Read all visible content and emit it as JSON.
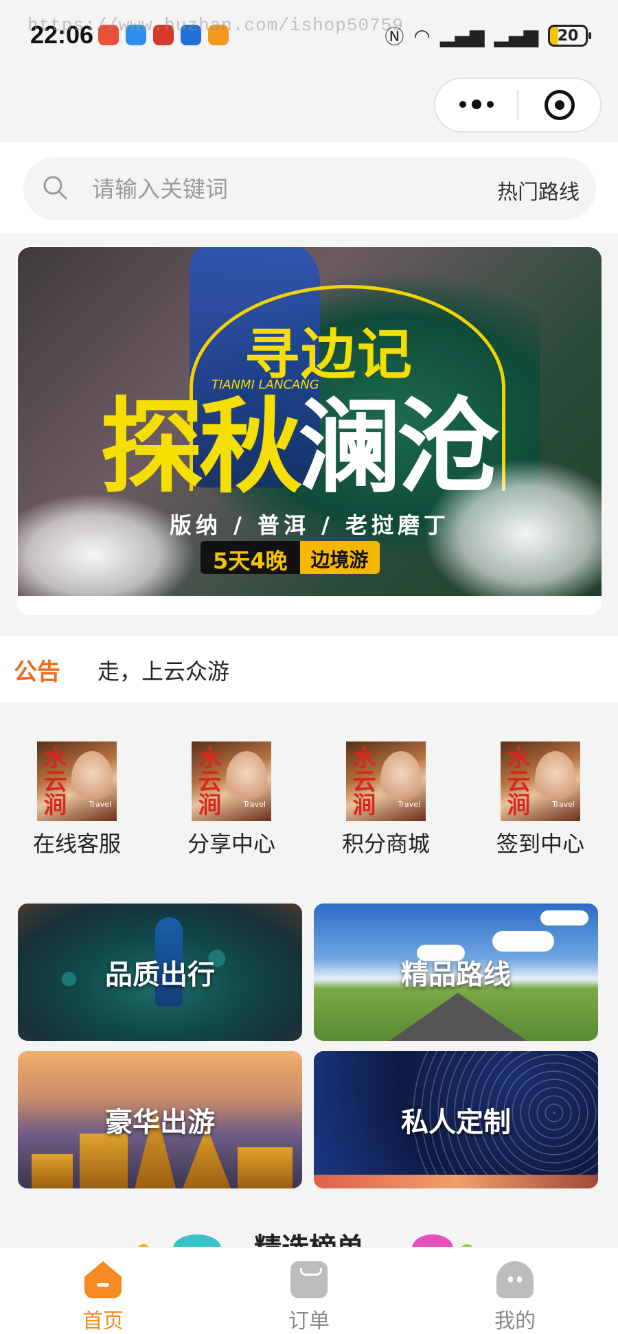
{
  "status_bar": {
    "time": "22:06",
    "watermark": "https://www.huzhan.com/ishop50759",
    "battery": "20"
  },
  "search": {
    "placeholder": "请输入关键词",
    "hot_routes_label": "热门路线"
  },
  "banner": {
    "title_line1": "寻边记",
    "title_line2_yellow": "探秋",
    "title_line2_white": "澜沧",
    "subtitle_en": "TIANMI LANCANG",
    "places": "版纳 / 普洱 / 老挝磨丁",
    "tag_days": "5天4晚",
    "tag_type": "边境游"
  },
  "notice": {
    "label": "公告",
    "text": "走，上云众游"
  },
  "quick_menu": {
    "thumb_text": "水云涧",
    "thumb_caption": "Travel",
    "items": [
      {
        "label": "在线客服"
      },
      {
        "label": "分享中心"
      },
      {
        "label": "积分商城"
      },
      {
        "label": "签到中心"
      }
    ]
  },
  "tiles": {
    "quality": "品质出行",
    "routes": "精品路线",
    "luxury": "豪华出游",
    "private": "私人定制"
  },
  "section": {
    "title": "精选榜单"
  },
  "tabbar": {
    "home": "首页",
    "orders": "订单",
    "mine": "我的",
    "active_color": "#f58a22",
    "inactive_color": "#888888"
  }
}
